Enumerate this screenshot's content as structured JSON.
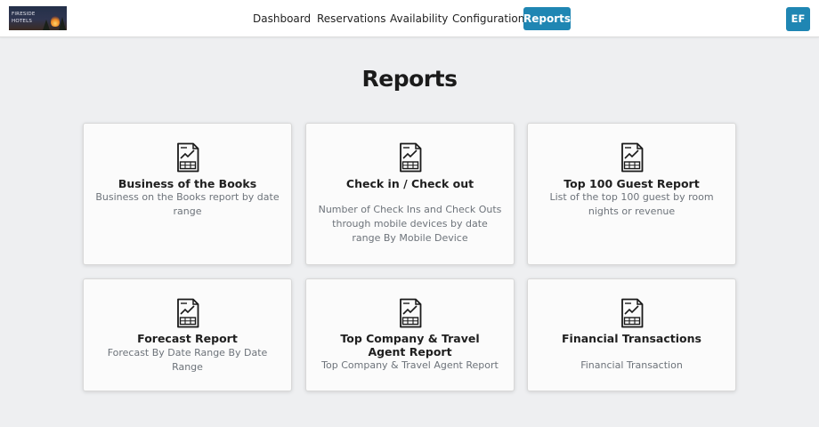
{
  "brand": {
    "line1": "FIRESIDE",
    "line2": "HOTELS"
  },
  "nav": {
    "items": [
      {
        "label": "Dashboard"
      },
      {
        "label": "Reservations"
      },
      {
        "label": "Availability"
      },
      {
        "label": "Configuration"
      },
      {
        "label": "Reports",
        "active": true
      }
    ]
  },
  "user": {
    "initials": "EF"
  },
  "page": {
    "title": "Reports"
  },
  "cards": [
    {
      "title": "Business of the Books",
      "description": "Business on the Books report by date range",
      "icon": "report-chart-icon"
    },
    {
      "title": "Check in / Check out",
      "description": "Number of Check Ins and Check Outs through mobile devices by date range By Mobile Device",
      "icon": "report-chart-icon"
    },
    {
      "title": "Top 100 Guest Report",
      "description": "List of the top 100 guest by room nights or revenue",
      "icon": "report-chart-icon"
    },
    {
      "title": "Forecast Report",
      "description": "Forecast By Date Range By Date Range",
      "icon": "report-chart-icon"
    },
    {
      "title": "Top Company & Travel Agent Report",
      "description": "Top Company & Travel Agent Report",
      "icon": "report-chart-icon"
    },
    {
      "title": "Financial Transactions",
      "description": "Financial Transaction",
      "icon": "report-chart-icon"
    }
  ],
  "colors": {
    "accent": "#1f86b3",
    "background": "#eeeff1",
    "card": "#fbfbfb"
  }
}
